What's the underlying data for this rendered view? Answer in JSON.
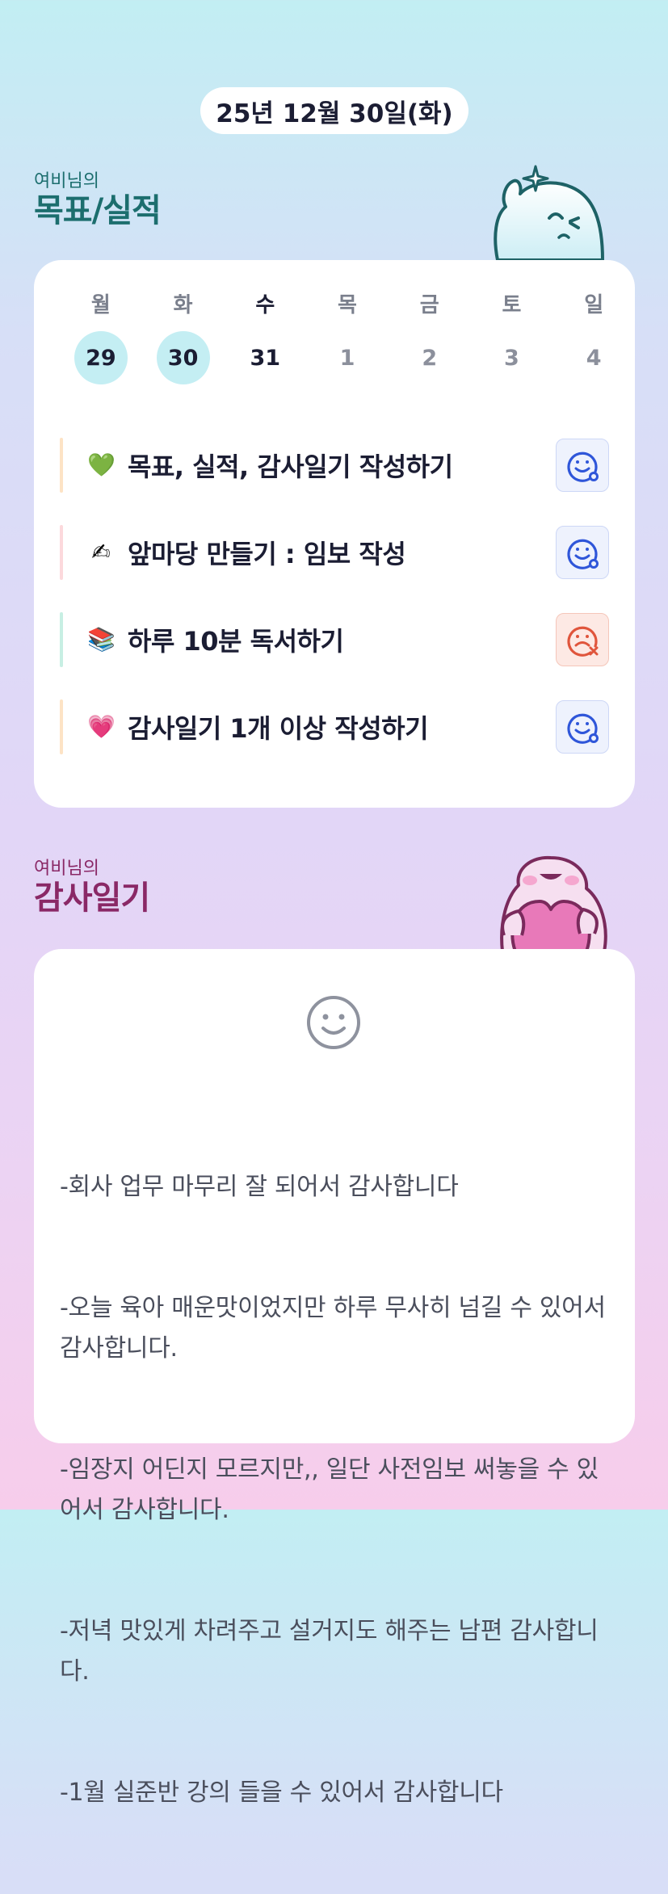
{
  "date_label": "25년 12월 30일(화)",
  "goals_section": {
    "subtitle": "여비님의",
    "title": "목표/실적"
  },
  "week": [
    {
      "name": "월",
      "num": "29",
      "state": "done"
    },
    {
      "name": "화",
      "num": "30",
      "state": "done"
    },
    {
      "name": "수",
      "num": "31",
      "state": "today"
    },
    {
      "name": "목",
      "num": "1",
      "state": "future"
    },
    {
      "name": "금",
      "num": "2",
      "state": "future"
    },
    {
      "name": "토",
      "num": "3",
      "state": "future"
    },
    {
      "name": "일",
      "num": "4",
      "state": "future"
    }
  ],
  "tasks": [
    {
      "emoji": "💚",
      "label": "목표, 실적, 감사일기 작성하기",
      "status": "ok",
      "bar_color": "#fde3c5"
    },
    {
      "emoji": "✍",
      "label": "앞마당 만들기 : 임보 작성",
      "status": "ok",
      "bar_color": "#fcd9dc"
    },
    {
      "emoji": "📚",
      "label": "하루 10분 독서하기",
      "status": "fail",
      "bar_color": "#c7efe3"
    },
    {
      "emoji": "💗",
      "label": "감사일기 1개 이상 작성하기",
      "status": "ok",
      "bar_color": "#fde3c5"
    }
  ],
  "status_icons": {
    "ok": "smile-check-icon",
    "fail": "sad-x-icon"
  },
  "colors": {
    "ok": "#2f56d9",
    "fail": "#e0553c",
    "done_day": "#c4eef3",
    "goals_title": "#1c6e6e",
    "grat_title": "#8a2866"
  },
  "gratitude_section": {
    "subtitle": "여비님의",
    "title": "감사일기"
  },
  "gratitude": {
    "icon": "smile-face-icon",
    "lines": [
      "-회사 업무 마무리 잘 되어서 감사합니다",
      "-오늘 육아 매운맛이었지만 하루 무사히 넘길 수 있어서 감사합니다.",
      "-임장지 어딘지 모르지만,, 일단 사전임보 써놓을 수 있어서 감사합니다.",
      "-저녁 맛있게 차려주고 설거지도 해주는 남편 감사합니다.",
      "-1월 실준반 강의 들을 수 있어서 감사합니다"
    ]
  }
}
